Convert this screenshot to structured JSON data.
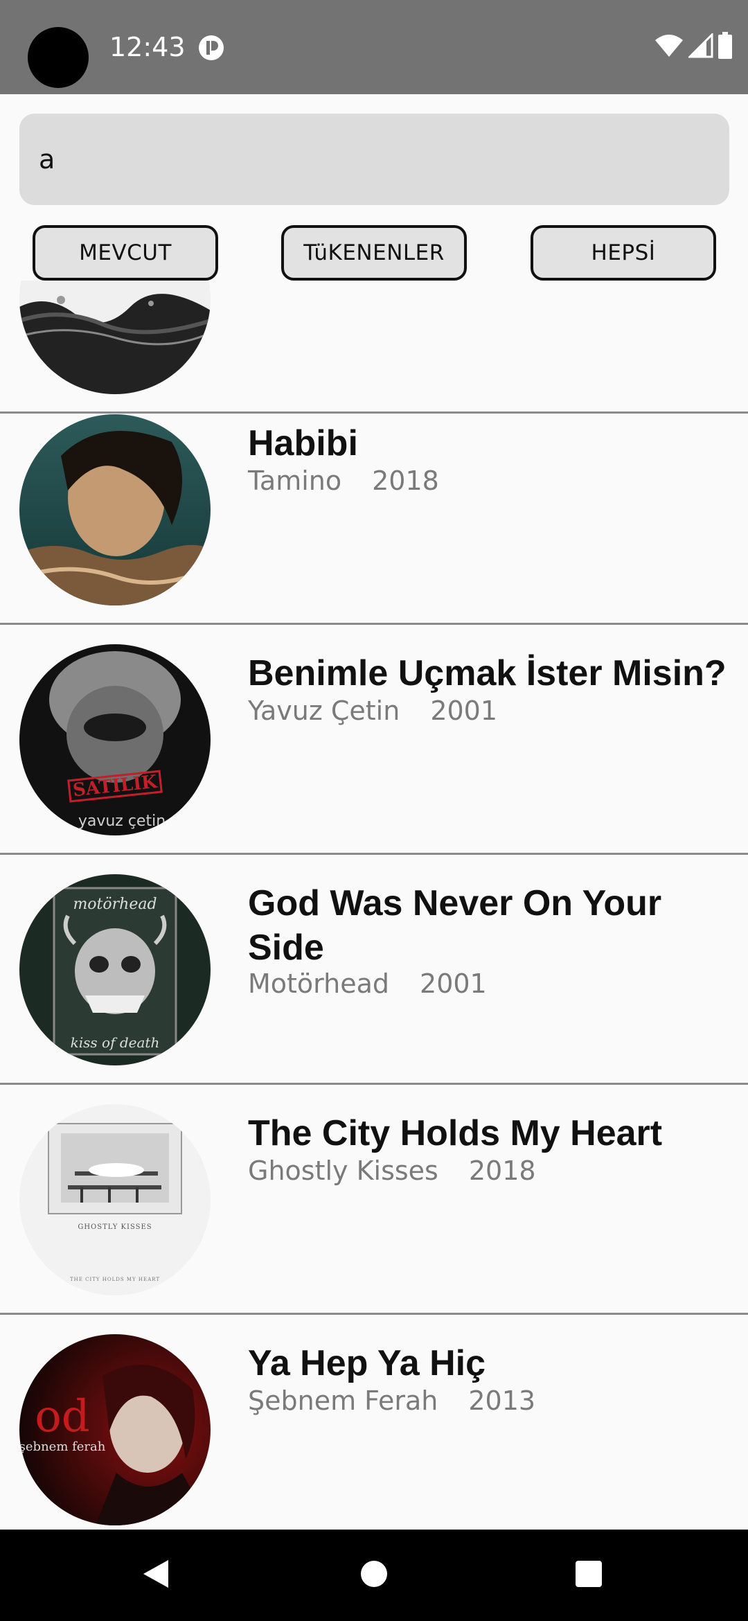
{
  "status_bar": {
    "time": "12:43",
    "icons": [
      "wifi-icon",
      "signal-icon",
      "battery-icon"
    ]
  },
  "search": {
    "value": "a"
  },
  "filters": [
    {
      "label": "MEVCUT"
    },
    {
      "label": "TüKENENLER"
    },
    {
      "label": "HEPSİ"
    }
  ],
  "albums": [
    {
      "title": "",
      "artist": "",
      "year": ""
    },
    {
      "title": "Habibi",
      "artist": "Tamino",
      "year": "2018"
    },
    {
      "title": "Benimle Uçmak İster Misin?",
      "artist": "Yavuz Çetin",
      "year": "2001"
    },
    {
      "title": "God Was Never On Your Side",
      "artist": "Motörhead",
      "year": "2001"
    },
    {
      "title": "The City Holds My Heart",
      "artist": "Ghostly Kisses",
      "year": "2018"
    },
    {
      "title": "Ya Hep Ya Hiç",
      "artist": "Şebnem Ferah",
      "year": "2013"
    }
  ],
  "covers": {
    "satilik_text": "SATILIK",
    "yavuz_text": "yavuz çetin",
    "motorhead_text": "motörhead",
    "kiss_text": "kiss of death",
    "ghostly_text": "GHOSTLY KISSES",
    "ghostly_sub": "THE CITY HOLDS MY HEART",
    "od_text": "od",
    "sebnem_text": "şebnem ferah"
  },
  "nav": {
    "icons": [
      "back-icon",
      "home-icon",
      "recents-icon"
    ]
  },
  "colors": {
    "status_bar": "#737373",
    "background": "#fafafa",
    "search_bg": "#dcdcdc",
    "meta_text": "#7a7a7a",
    "divider": "#8a8a8a"
  }
}
